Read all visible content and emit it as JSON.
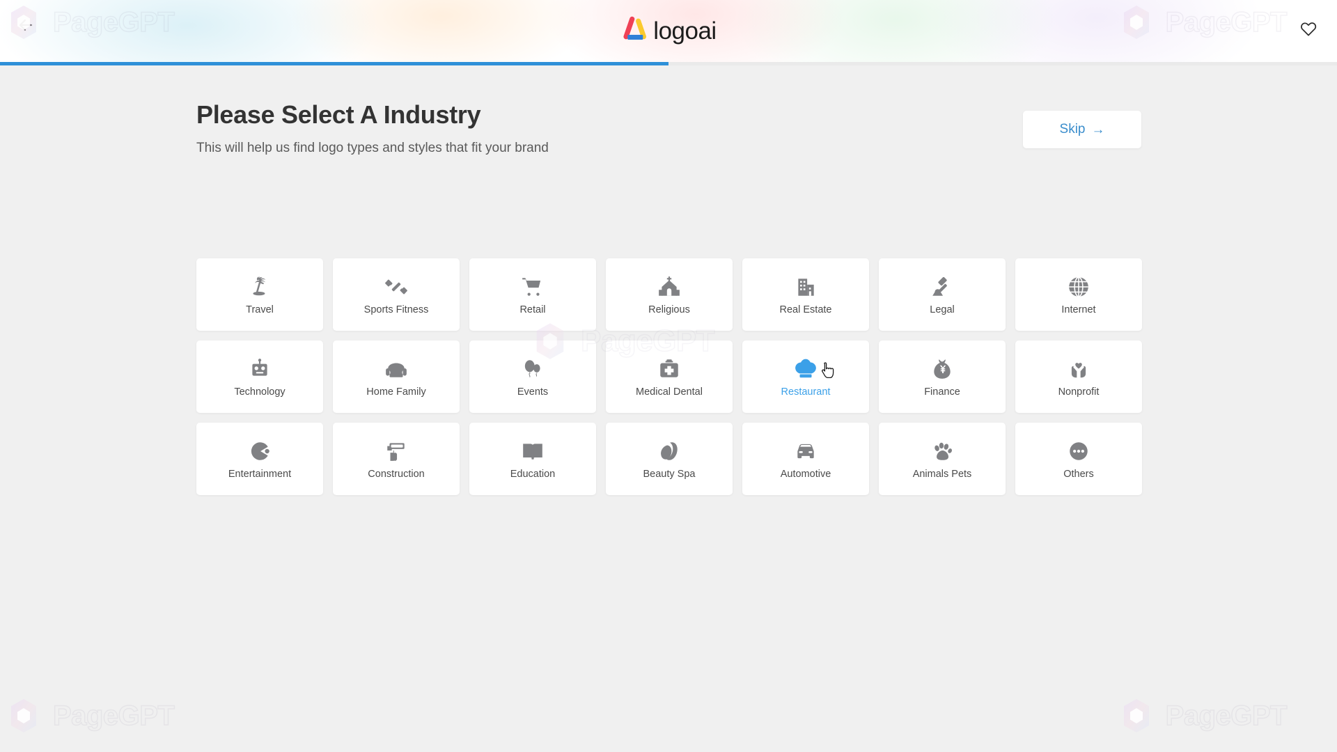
{
  "header": {
    "back_icon": "arrow-left-icon",
    "brand_name": "logoai",
    "brand_logo_icon": "logoai-triangle-icon",
    "favorite_icon": "heart-outline-icon",
    "accent_color": "#3ba0e8"
  },
  "progress": {
    "percent": 50,
    "fill_color": "#2f90d8",
    "track_color": "#eaeaea"
  },
  "page": {
    "title": "Please Select A Industry",
    "subtitle": "This will help us find logo types and styles that fit your brand"
  },
  "skip": {
    "label": "Skip",
    "arrow": "→",
    "icon": "arrow-right-icon",
    "color": "#3a8dcc"
  },
  "industries": [
    {
      "label": "Travel",
      "icon": "palm-tree-icon",
      "selected": false
    },
    {
      "label": "Sports Fitness",
      "icon": "dumbbell-icon",
      "selected": false
    },
    {
      "label": "Retail",
      "icon": "shopping-cart-icon",
      "selected": false
    },
    {
      "label": "Religious",
      "icon": "church-icon",
      "selected": false
    },
    {
      "label": "Real Estate",
      "icon": "building-icon",
      "selected": false
    },
    {
      "label": "Legal",
      "icon": "gavel-icon",
      "selected": false
    },
    {
      "label": "Internet",
      "icon": "globe-icon",
      "selected": false
    },
    {
      "label": "Technology",
      "icon": "robot-icon",
      "selected": false
    },
    {
      "label": "Home Family",
      "icon": "armchair-icon",
      "selected": false
    },
    {
      "label": "Events",
      "icon": "balloons-icon",
      "selected": false
    },
    {
      "label": "Medical Dental",
      "icon": "first-aid-kit-icon",
      "selected": false
    },
    {
      "label": "Restaurant",
      "icon": "chef-hat-icon",
      "selected": true
    },
    {
      "label": "Finance",
      "icon": "money-bag-icon",
      "selected": false
    },
    {
      "label": "Nonprofit",
      "icon": "hands-heart-icon",
      "selected": false
    },
    {
      "label": "Entertainment",
      "icon": "pacman-icon",
      "selected": false
    },
    {
      "label": "Construction",
      "icon": "paint-roller-icon",
      "selected": false
    },
    {
      "label": "Education",
      "icon": "open-book-icon",
      "selected": false
    },
    {
      "label": "Beauty Spa",
      "icon": "beauty-face-icon",
      "selected": false
    },
    {
      "label": "Automotive",
      "icon": "car-icon",
      "selected": false
    },
    {
      "label": "Animals Pets",
      "icon": "paw-print-icon",
      "selected": false
    },
    {
      "label": "Others",
      "icon": "ellipsis-circle-icon",
      "selected": false
    }
  ],
  "watermark": {
    "text": "PageGPT"
  }
}
